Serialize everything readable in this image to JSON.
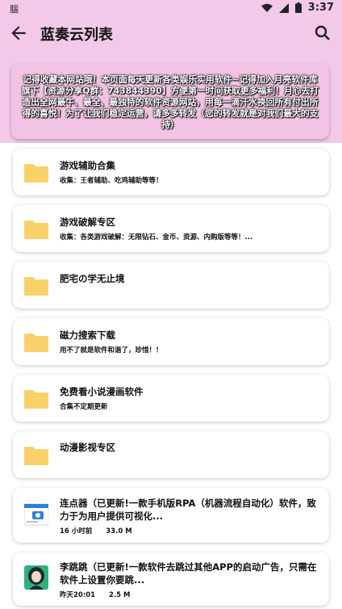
{
  "status_bar": {
    "left_text": "腦",
    "time": "3:37"
  },
  "toolbar": {
    "title": "蓝奏云列表"
  },
  "banner": {
    "text": "记得收藏本网站哦！本页面每天更新各类娱乐实用软件~记得加入月亮软件库旗下【资源分享Q群：743844390】方便第一时间获取更多福利！月心去打造出全网最牛、最全、最独特的软件资源网站，用每一滴汗水换回所有付出所得的喜悦！为了让我们稳定运营，请多多转发（您的转发就是对我们最大的支持）"
  },
  "folders": [
    {
      "title": "游戏辅助合集",
      "desc": "收集：王者辅助、吃鸡辅助等等！"
    },
    {
      "title": "游戏破解专区",
      "desc": "收集：各类游戏破解：无限钻石、金币、资源、内购版等等！..."
    },
    {
      "title": "肥宅の学无止境",
      "desc": ""
    },
    {
      "title": "磁力搜索下载",
      "desc": "用不了就是软件和谐了，珍惜！！"
    },
    {
      "title": "免费看小说漫画软件",
      "desc": "合集不定期更新"
    },
    {
      "title": "动漫影视专区",
      "desc": ""
    }
  ],
  "apps": [
    {
      "title": "连点器（已更新!一款手机版RPA（机器流程自动化）软件，致力于为用户提供可视化...",
      "time": "16 小时前",
      "size": "33.0 M",
      "icon": "tap-app-icon"
    },
    {
      "title": "李跳跳（已更新!一款软件去跳过其他APP的启动广告，只需在软件上设置你要跳...",
      "time": "昨天20:01",
      "size": "2.5 M",
      "icon": "girl-avatar-icon"
    }
  ],
  "colors": {
    "header_bg": "#f2c9e8",
    "banner_card": "#f2c3e5",
    "folder": "#f8d16a"
  }
}
